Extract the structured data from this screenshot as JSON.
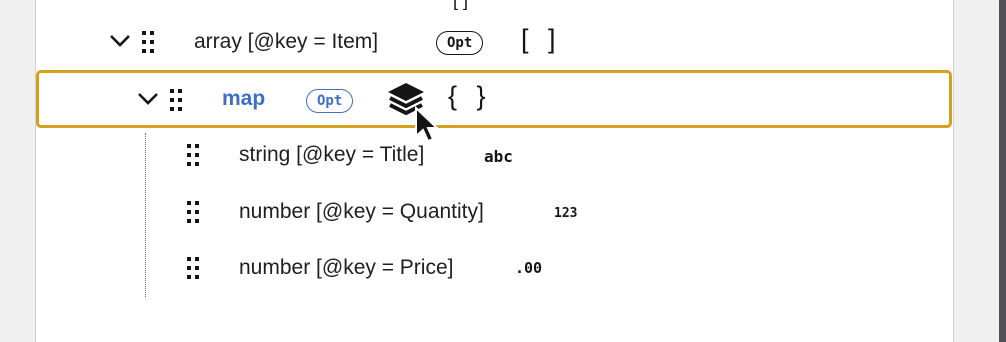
{
  "top_bracket": "[ ]",
  "rows": [
    {
      "label": "array [@key = Item]",
      "badge": "Opt",
      "type_glyph": "[ ]"
    },
    {
      "label": "map",
      "badge": "Opt",
      "type_glyph": "{ }"
    },
    {
      "label": "string [@key = Title]",
      "type_glyph": "abc"
    },
    {
      "label": "number [@key = Quantity]",
      "type_glyph": "123"
    },
    {
      "label": "number [@key = Price]",
      "type_glyph": ".00"
    }
  ],
  "icons": {
    "expand": "chevron-down-icon",
    "drag": "grip-icon",
    "layers": "layers-icon",
    "cursor": "mouse-pointer-icon"
  },
  "colors": {
    "selection_border": "#d6a01d",
    "selected_text": "#3d6fc9"
  }
}
